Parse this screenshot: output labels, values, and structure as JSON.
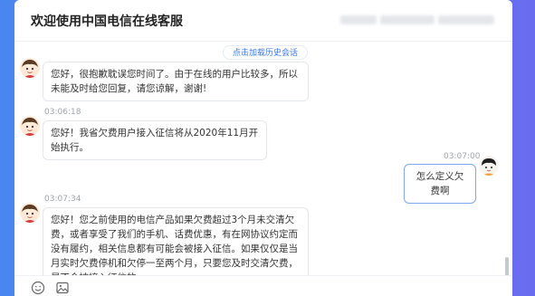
{
  "header": {
    "title": "欢迎使用中国电信在线客服"
  },
  "chat": {
    "history_link": "点击加载历史会话",
    "messages": [
      {
        "sender": "agent",
        "time": "",
        "text": "您好，很抱歉耽误您时间了。由于在线的用户比较多，所以未能及时给您回复，请您谅解，谢谢!"
      },
      {
        "sender": "agent",
        "time": "03:06:18",
        "text": "您好！我省欠费用户接入征信将从2020年11月开始执行。"
      },
      {
        "sender": "user",
        "time": "03:07:00",
        "text": "怎么定义欠费啊"
      },
      {
        "sender": "agent",
        "time": "03:07:34",
        "text": "您好！您之前使用的电信产品如果欠费超过3个月未交清欠费，或者享受了我们的手机、话费优惠，有在网协议约定而没有履约，相关信息都有可能会被接入征信。如果仅仅是当月实时欠费停机和欠停一至两个月，只要您及时交清欠费，是不会被接入征信的。"
      }
    ]
  },
  "toolbar": {
    "icons": [
      "emoji-icon",
      "image-icon"
    ]
  },
  "colors": {
    "background_gradient_start": "#4a86f0",
    "background_gradient_end": "#6a6cf0",
    "link": "#3a78f2",
    "user_bubble_border": "#7fa6ee"
  }
}
